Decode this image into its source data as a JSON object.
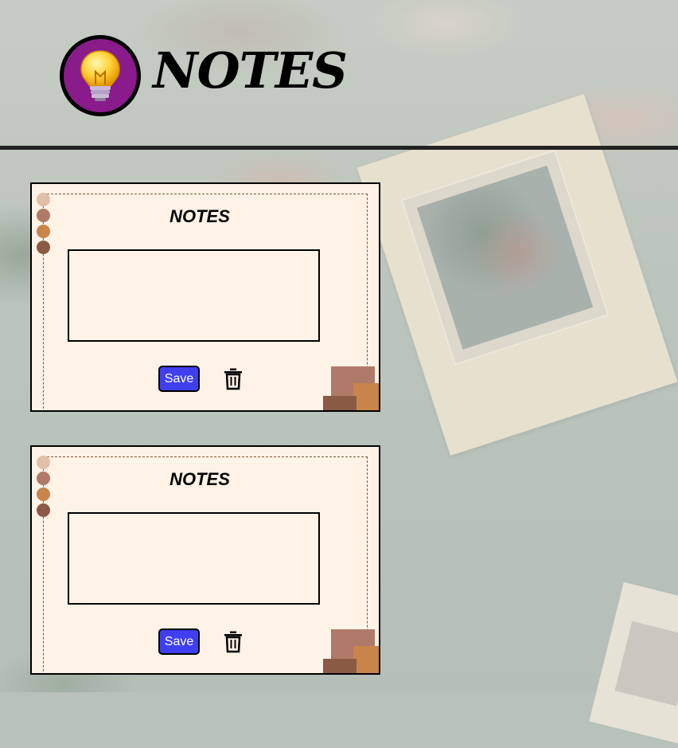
{
  "app": {
    "title": "NOTES",
    "logo_icon": "lightbulb-icon",
    "logo_color": "#8a1b8b"
  },
  "palette": {
    "dots": [
      "#e2bfa8",
      "#b07a68",
      "#c8844a",
      "#8a5a44"
    ],
    "save_button_color": "#3f3ff0",
    "card_background": "#fff2e6"
  },
  "notes": [
    {
      "title": "NOTES",
      "text": "",
      "placeholder": "",
      "save_label": "Save",
      "delete_icon": "trash-icon"
    },
    {
      "title": "NOTES",
      "text": "",
      "placeholder": "",
      "save_label": "Save",
      "delete_icon": "trash-icon"
    }
  ]
}
